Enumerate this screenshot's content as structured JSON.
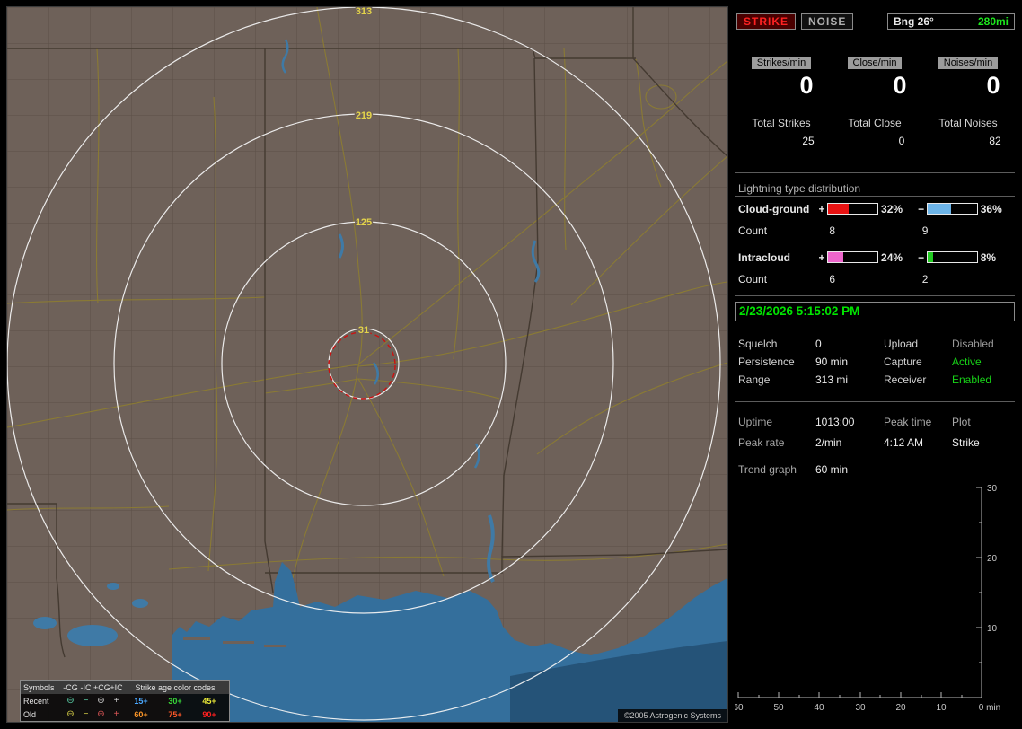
{
  "map": {
    "ring_labels": [
      "313",
      "219",
      "125",
      "31"
    ],
    "legend": {
      "symbols_header": "Symbols",
      "col_headers": [
        "-CG",
        "-IC",
        "+CG",
        "+IC"
      ],
      "age_header": "Strike age color codes",
      "rows": [
        {
          "label": "Recent",
          "symbols": [
            {
              "glyph": "⊖",
              "color": "#5ad0a8"
            },
            {
              "glyph": "−",
              "color": "#5ad0a8"
            },
            {
              "glyph": "⊕",
              "color": "#cfcfcf"
            },
            {
              "glyph": "+",
              "color": "#cfcfcf"
            }
          ],
          "ages": [
            {
              "text": "15+",
              "color": "#4aa8ff"
            },
            {
              "text": "30+",
              "color": "#38d838"
            },
            {
              "text": "45+",
              "color": "#e8e838"
            }
          ]
        },
        {
          "label": "Old",
          "symbols": [
            {
              "glyph": "⊖",
              "color": "#d8d048"
            },
            {
              "glyph": "−",
              "color": "#d8d048"
            },
            {
              "glyph": "⊕",
              "color": "#e05858"
            },
            {
              "glyph": "+",
              "color": "#e05858"
            }
          ],
          "ages": [
            {
              "text": "60+",
              "color": "#ff9828"
            },
            {
              "text": "75+",
              "color": "#ff5828"
            },
            {
              "text": "90+",
              "color": "#ff2020"
            }
          ]
        }
      ]
    },
    "copyright": "©2005 Astrogenic Systems"
  },
  "panel": {
    "indicators": {
      "strike": "STRIKE",
      "noise": "NOISE",
      "bearing": "Bng 26°",
      "distance": "280mi",
      "distance_color": "#1de81d"
    },
    "rates": [
      {
        "label": "Strikes/min",
        "value": "0"
      },
      {
        "label": "Close/min",
        "value": "0"
      },
      {
        "label": "Noises/min",
        "value": "0"
      }
    ],
    "totals": [
      {
        "label": "Total Strikes",
        "value": "25"
      },
      {
        "label": "Total Close",
        "value": "0"
      },
      {
        "label": "Total Noises",
        "value": "82"
      }
    ],
    "distribution": {
      "title": "Lightning type distribution",
      "rows": [
        {
          "label": "Cloud-ground",
          "pos_sign": "+",
          "neg_sign": "−",
          "pos_pct": "32%",
          "neg_pct": "36%",
          "pos_fill": 32,
          "neg_fill": 36,
          "pos_color": "#e81212",
          "neg_color": "#6cb4e8",
          "count_label": "Count",
          "pos_count": "8",
          "neg_count": "9"
        },
        {
          "label": "Intracloud",
          "pos_sign": "+",
          "neg_sign": "−",
          "pos_pct": "24%",
          "neg_pct": "8%",
          "pos_fill": 24,
          "neg_fill": 8,
          "pos_color": "#ee66cc",
          "neg_color": "#22cc22",
          "count_label": "Count",
          "pos_count": "6",
          "neg_count": "2"
        }
      ]
    },
    "datetime": "2/23/2026 5:15:02 PM",
    "settings": [
      {
        "l1": "Squelch",
        "v1": "0",
        "l2": "Upload",
        "v2": "Disabled",
        "v2_color": "#9a9a9a"
      },
      {
        "l1": "Persistence",
        "v1": "90 min",
        "l2": "Capture",
        "v2": "Active",
        "v2_color": "#18d418"
      },
      {
        "l1": "Range",
        "v1": "313 mi",
        "l2": "Receiver",
        "v2": "Enabled",
        "v2_color": "#18d418"
      }
    ],
    "status": {
      "uptime_label": "Uptime",
      "uptime": "1013:00",
      "peak_time_label": "Peak time",
      "plot_label": "Plot",
      "peak_rate_label": "Peak rate",
      "peak_rate": "2/min",
      "peak_time": "4:12 AM",
      "plot": "Strike"
    },
    "trend": {
      "label": "Trend graph",
      "value": "60 min",
      "x_ticks": [
        "60",
        "50",
        "40",
        "30",
        "20",
        "10",
        "0 min"
      ],
      "y_ticks": [
        "30",
        "20",
        "10"
      ],
      "x_range_min": 0,
      "x_range_max": 60,
      "y_range_min": 0,
      "y_range_max": 30
    }
  }
}
